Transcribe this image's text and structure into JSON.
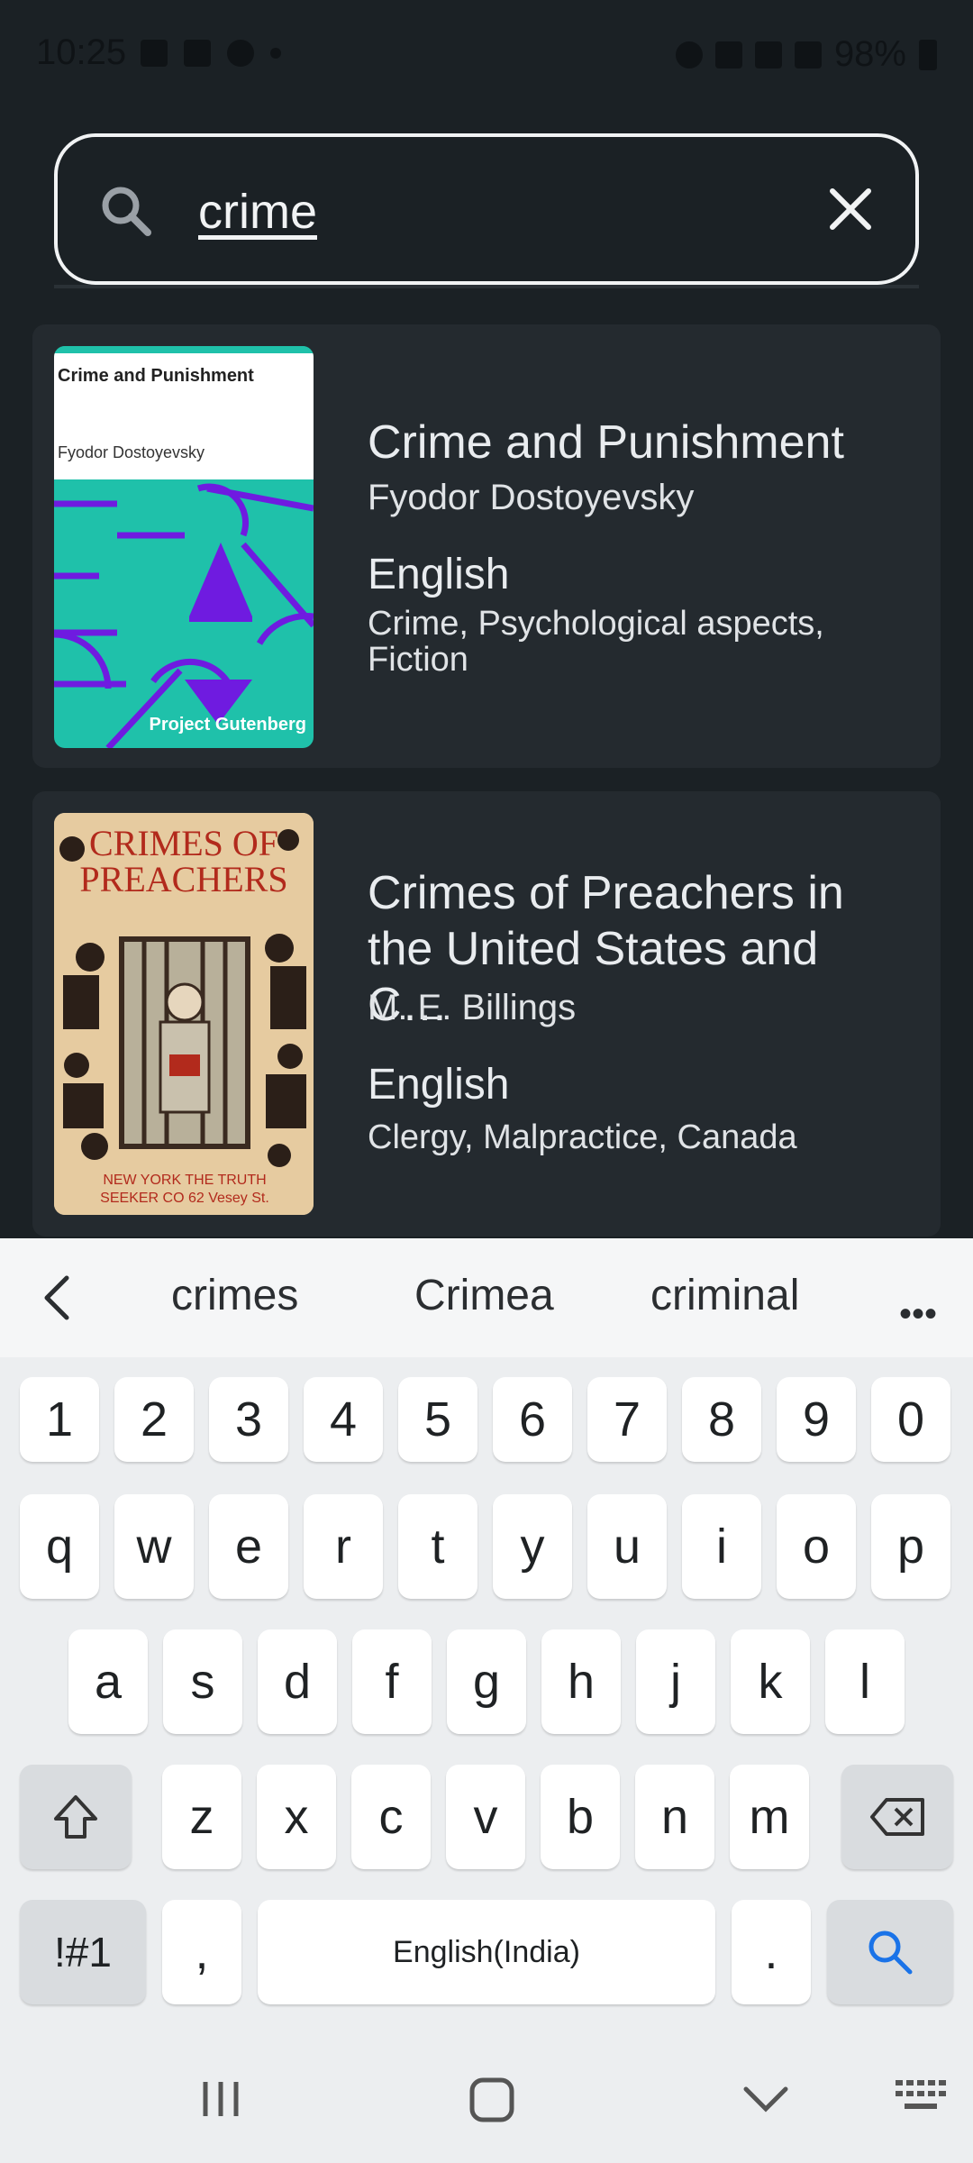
{
  "status_bar": {
    "time": "10:25",
    "battery": "98%"
  },
  "search": {
    "value": "crime"
  },
  "results": [
    {
      "cover_title": "Crime and Punishment",
      "cover_author": "Fyodor Dostoyevsky",
      "cover_publisher": "Project Gutenberg",
      "title": "Crime and Punishment",
      "author": "Fyodor Dostoyevsky",
      "language": "English",
      "subjects": "Crime, Psychological aspects, Fiction"
    },
    {
      "cover_title": "CRIMES OF PREACHERS",
      "cover_publisher": "NEW YORK THE TRUTH SEEKER CO 62 Vesey St.",
      "title": "Crimes of Preachers in the United States and C…",
      "author": "M. E. Billings",
      "language": "English",
      "subjects": "Clergy, Malpractice, Canada"
    }
  ],
  "keyboard": {
    "suggestions": [
      "crimes",
      "Crimea",
      "criminal"
    ],
    "more": "•••",
    "row_numbers": [
      "1",
      "2",
      "3",
      "4",
      "5",
      "6",
      "7",
      "8",
      "9",
      "0"
    ],
    "row1": [
      "q",
      "w",
      "e",
      "r",
      "t",
      "y",
      "u",
      "i",
      "o",
      "p"
    ],
    "row2": [
      "a",
      "s",
      "d",
      "f",
      "g",
      "h",
      "j",
      "k",
      "l"
    ],
    "row3": [
      "z",
      "x",
      "c",
      "v",
      "b",
      "n",
      "m"
    ],
    "symbols_label": "!#1",
    "comma": ",",
    "space_label": "English(India)",
    "period": "."
  },
  "colors": {
    "background": "#1b2125",
    "card": "#242a2f",
    "cover_teal": "#1fc1aa",
    "cover_purple": "#6f1be0",
    "search_accent": "#1a73e8"
  }
}
